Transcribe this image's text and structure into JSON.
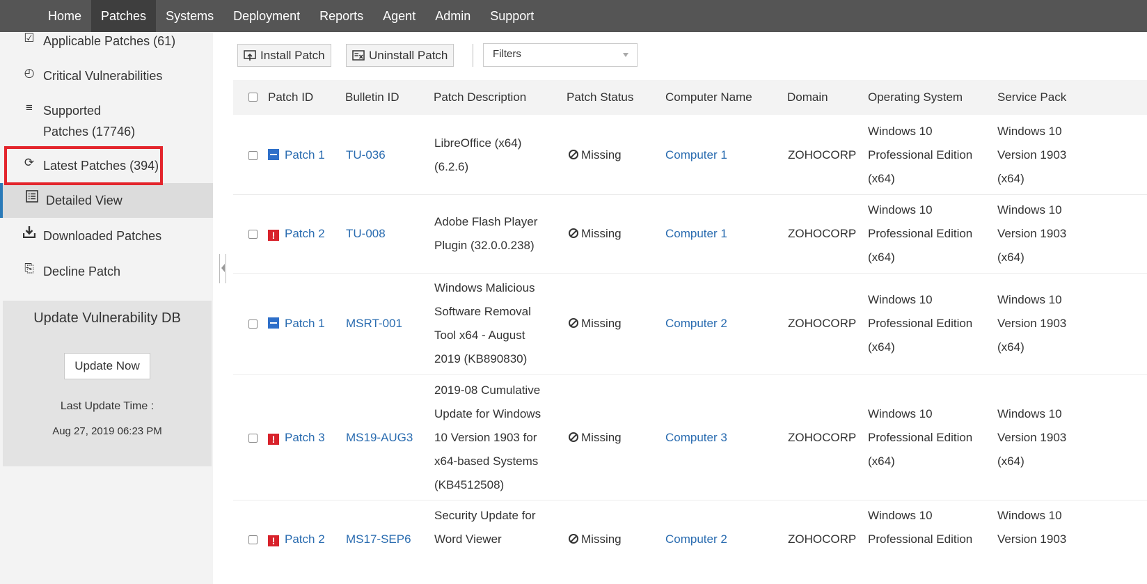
{
  "nav": [
    "Home",
    "Patches",
    "Systems",
    "Deployment",
    "Reports",
    "Agent",
    "Admin",
    "Support"
  ],
  "sidebar": {
    "items": [
      {
        "label": "Applicable Patches (61)",
        "icon": "checklist-icon"
      },
      {
        "label": "Critical Vulnerabilities",
        "icon": "calendar-alert-icon"
      },
      {
        "label": "Supported",
        "label2": "Patches (17746)",
        "icon": "list-icon"
      },
      {
        "label": "Latest Patches (394)",
        "icon": "refresh-icon"
      },
      {
        "label": "Detailed View",
        "icon": "detail-list-icon"
      },
      {
        "label": "Downloaded Patches",
        "icon": "download-icon"
      },
      {
        "label": "Decline Patch",
        "icon": "decline-icon"
      }
    ],
    "vuln_title": "Update Vulnerability DB",
    "update_button": "Update Now",
    "last_update_label": "Last Update Time :",
    "last_update_value": "Aug 27, 2019 06:23 PM"
  },
  "toolbar": {
    "install": "Install Patch",
    "uninstall": "Uninstall Patch",
    "filter": "Filters"
  },
  "table": {
    "headers": [
      "Patch ID",
      "Bulletin ID",
      "Patch Description",
      "Patch Status",
      "Computer Name",
      "Domain",
      "Operating System",
      "Service Pack"
    ],
    "rows": [
      {
        "severity": "low",
        "patch": "Patch 1",
        "bulletin": "TU-036",
        "desc": [
          "LibreOffice (x64)",
          "(6.2.6)"
        ],
        "status": "Missing",
        "computer": "Computer 1",
        "domain": "ZOHOCORP",
        "os": [
          "Windows 10",
          "Professional Edition",
          "(x64)"
        ],
        "sp": [
          "Windows 10",
          "Version 1903",
          "(x64)"
        ]
      },
      {
        "severity": "critical",
        "patch": "Patch 2",
        "bulletin": "TU-008",
        "desc": [
          "Adobe Flash Player",
          "Plugin (32.0.0.238)"
        ],
        "status": "Missing",
        "computer": "Computer 1",
        "domain": "ZOHOCORP",
        "os": [
          "Windows 10",
          "Professional Edition",
          "(x64)"
        ],
        "sp": [
          "Windows 10",
          "Version 1903",
          "(x64)"
        ]
      },
      {
        "severity": "low",
        "patch": "Patch 1",
        "bulletin": "MSRT-001",
        "desc": [
          "Windows Malicious",
          "Software Removal",
          "Tool x64 - August",
          "2019 (KB890830)"
        ],
        "status": "Missing",
        "computer": "Computer 2",
        "domain": "ZOHOCORP",
        "os": [
          "Windows 10",
          "Professional Edition",
          "(x64)"
        ],
        "sp": [
          "Windows 10",
          "Version 1903",
          "(x64)"
        ]
      },
      {
        "severity": "critical",
        "patch": "Patch 3",
        "bulletin": "MS19-AUG3",
        "desc": [
          "2019-08 Cumulative",
          "Update for Windows",
          "10 Version 1903 for",
          "x64-based Systems",
          "(KB4512508)"
        ],
        "status": "Missing",
        "computer": "Computer 3",
        "domain": "ZOHOCORP",
        "os": [
          "Windows 10",
          "Professional Edition",
          "(x64)"
        ],
        "sp": [
          "Windows 10",
          "Version 1903",
          "(x64)"
        ]
      },
      {
        "severity": "critical",
        "patch": "Patch 2",
        "bulletin": "MS17-SEP6",
        "desc": [
          "Security Update for",
          "Word Viewer"
        ],
        "status": "Missing",
        "computer": "Computer 2",
        "domain": "ZOHOCORP",
        "os": [
          "Windows 10",
          "Professional Edition"
        ],
        "sp": [
          "Windows 10",
          "Version 1903"
        ]
      }
    ]
  }
}
